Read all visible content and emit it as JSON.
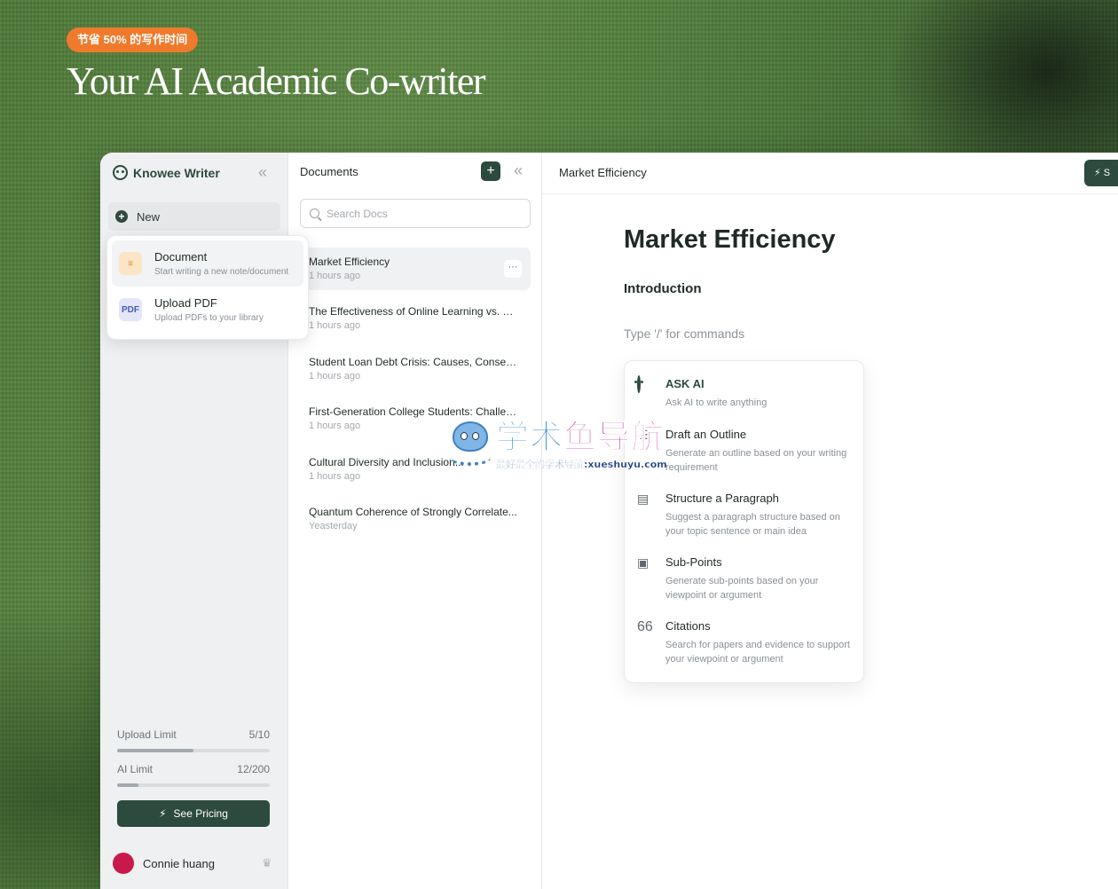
{
  "hero": {
    "badge": "节省 50% 的写作时间",
    "title": "Your AI Academic Co-writer"
  },
  "sidebar": {
    "brand": "Knowee Writer",
    "collapse_icon": "«",
    "new_label": "New",
    "new_menu": [
      {
        "title": "Document",
        "subtitle": "Start writing a new note/document",
        "icon": "document-icon"
      },
      {
        "title": "Upload PDF",
        "subtitle": "Upload PDFs to your library",
        "icon": "pdf-icon"
      }
    ],
    "upload_limit": {
      "label": "Upload Limit",
      "value": "5/10",
      "fraction": 0.5
    },
    "ai_limit": {
      "label": "AI Limit",
      "value": "12/200",
      "fraction": 0.06
    },
    "pricing_label": "See Pricing",
    "user": {
      "name": "Connie huang",
      "avatar_color": "#c8194d"
    }
  },
  "documents": {
    "title": "Documents",
    "search_placeholder": "Search Docs",
    "items": [
      {
        "name": "Market Efficiency",
        "time": "1 hours ago"
      },
      {
        "name": "The Effectiveness of Online Learning vs. Tr...",
        "time": "1 hours ago"
      },
      {
        "name": "Student Loan Debt Crisis: Causes, Conseq...",
        "time": "1 hours ago"
      },
      {
        "name": "First-Generation College Students: Challen...",
        "time": "1 hours ago"
      },
      {
        "name": "Cultural Diversity and Inclusion...",
        "time": "1 hours ago"
      },
      {
        "name": "Quantum Coherence of Strongly Correlate...",
        "time": "Yeasterday"
      }
    ]
  },
  "editor": {
    "tab_title": "Market Efficiency",
    "top_action_label": "S",
    "heading": "Market Efficiency",
    "section": "Introduction",
    "command_hint": "Type '/' for commands",
    "commands": [
      {
        "title": "ASK AI",
        "desc": "Ask AI to write anything",
        "icon": "owl-icon"
      },
      {
        "title": "Draft an Outline",
        "desc": "Generate an outline based on your writing requirement",
        "icon": "outline-icon"
      },
      {
        "title": "Structure a Paragraph",
        "desc": "Suggest a paragraph structure based on your topic sentence or main idea",
        "icon": "structure-icon"
      },
      {
        "title": "Sub-Points",
        "desc": "Generate sub-points based on your viewpoint or argument",
        "icon": "list-icon"
      },
      {
        "title": "Citations",
        "desc": "Search for papers and evidence to support your viewpoint or argument",
        "icon": "quote-icon"
      }
    ]
  },
  "watermark": {
    "title_a": "学术",
    "title_b": "鱼导航",
    "subtitle": "最好最全的学术导航:xueshuyu.com"
  },
  "colors": {
    "brand": "#2d4a3e",
    "badge": "#f07a2c",
    "avatar": "#c8194d"
  }
}
